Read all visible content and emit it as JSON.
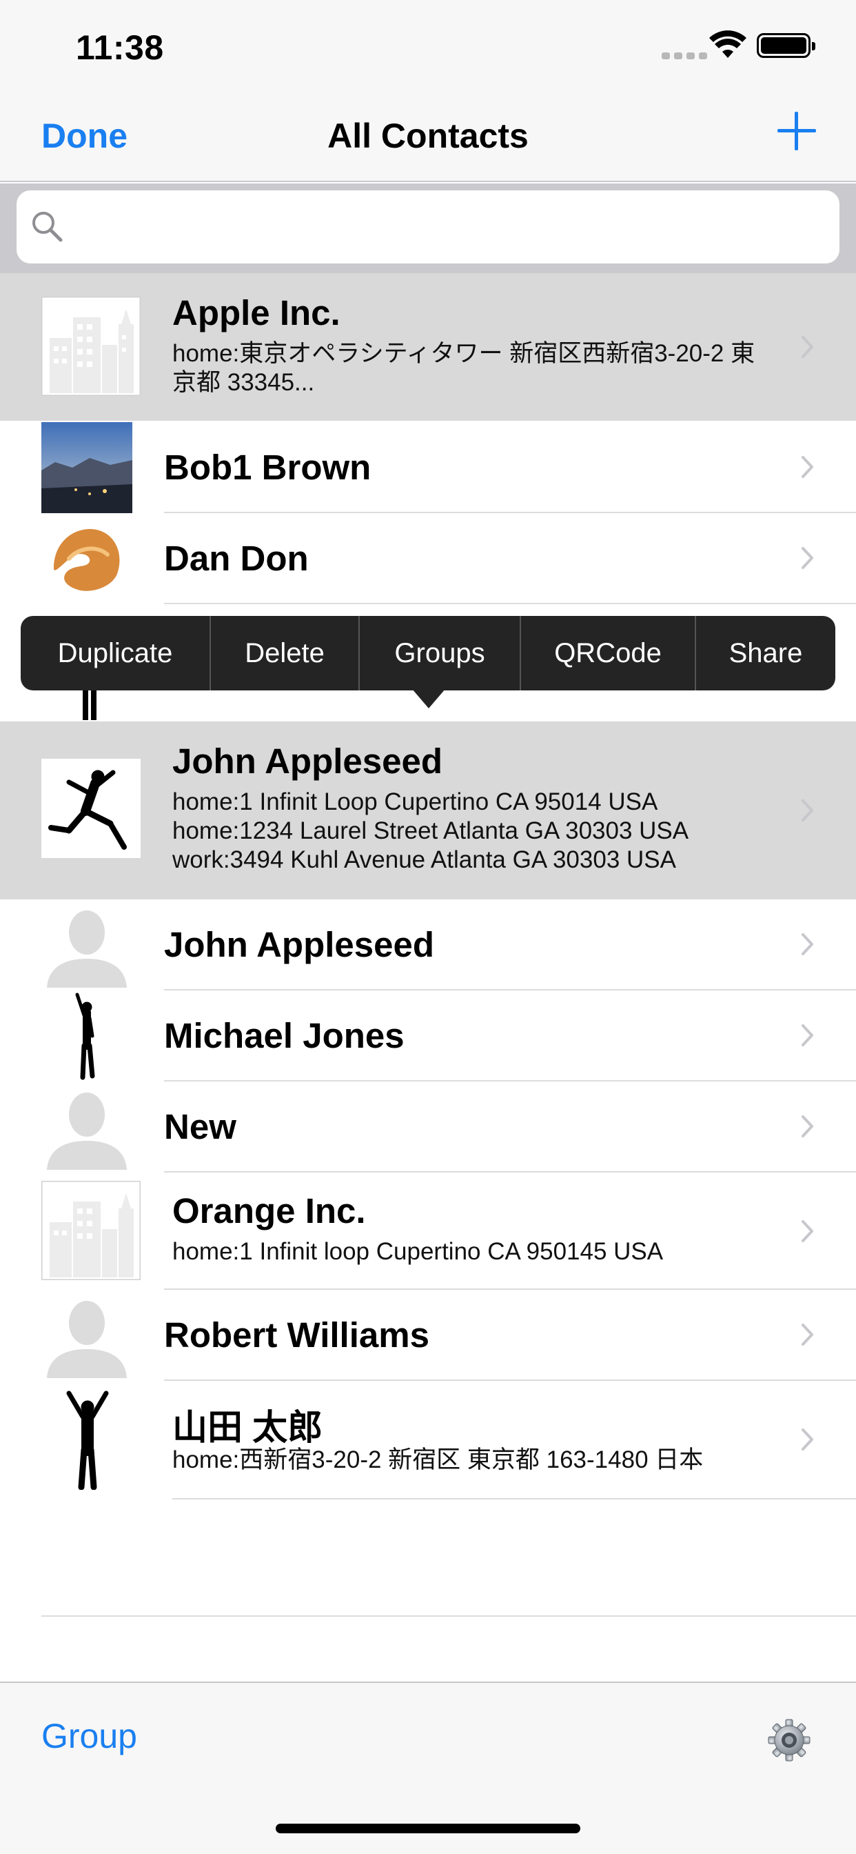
{
  "status_bar": {
    "time": "11:38"
  },
  "nav": {
    "done_label": "Done",
    "title": "All Contacts",
    "add_icon": "plus-icon"
  },
  "search": {
    "value": "",
    "placeholder": ""
  },
  "contacts": [
    {
      "name": "Apple Inc.",
      "detail": "home:東京オペラシティタワー 新宿区西新宿3-20-2 東京都 33345...",
      "avatar": "building-avatar"
    },
    {
      "name": "Bob1 Brown",
      "avatar": "photo-avatar"
    },
    {
      "name": "Dan Don",
      "avatar": "fortune-cookie-avatar"
    },
    {
      "name": "John Appleseed",
      "detail_lines": [
        "home:1 Infinit Loop Cupertino CA 95014 USA",
        "home:1234 Laurel Street Atlanta GA 30303 USA",
        "work:3494 Kuhl Avenue Atlanta GA 30303 USA"
      ],
      "avatar": "silhouette-jump-avatar"
    },
    {
      "name": "John Appleseed",
      "avatar": "person-placeholder-avatar"
    },
    {
      "name": "Michael Jones",
      "avatar": "silhouette-avatar"
    },
    {
      "name": "New",
      "avatar": "person-placeholder-avatar"
    },
    {
      "name": "Orange Inc.",
      "detail": "home:1 Infinit loop Cupertino CA 950145 USA",
      "avatar": "building-avatar"
    },
    {
      "name": "Robert Williams",
      "avatar": "person-placeholder-avatar"
    },
    {
      "name": "山田 太郎",
      "detail": "home:西新宿3-20-2 新宿区 東京都 163-1480 日本",
      "avatar": "silhouette-arms-up-avatar"
    }
  ],
  "context_menu": {
    "items": [
      "Duplicate",
      "Delete",
      "Groups",
      "QRCode",
      "Share"
    ]
  },
  "toolbar": {
    "group_label": "Group",
    "settings_icon": "gear-icon"
  }
}
